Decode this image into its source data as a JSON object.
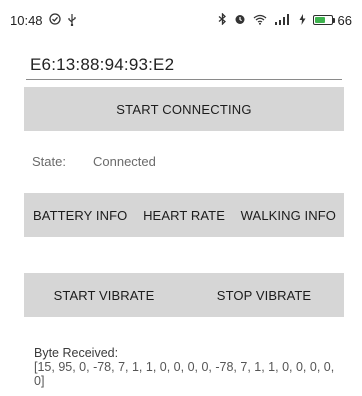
{
  "status_bar": {
    "time": "10:48",
    "left_icons": [
      "clock-check-icon",
      "usb-icon"
    ],
    "right_icons": [
      "bluetooth-icon",
      "alarm-icon",
      "wifi-icon",
      "signal-icon",
      "charging-icon"
    ],
    "signal_text": "ᶦₗₗ",
    "battery_level": "66",
    "battery_fraction": 0.66,
    "battery_color": "#3fb34f"
  },
  "device": {
    "address": "E6:13:88:94:93:E2"
  },
  "buttons": {
    "start_connecting": "START CONNECTING",
    "battery_info": "BATTERY INFO",
    "heart_rate": "HEART RATE",
    "walking_info": "WALKING INFO",
    "start_vibrate": "START VIBRATE",
    "stop_vibrate": "STOP VIBRATE"
  },
  "state": {
    "label": "State:",
    "value": "Connected"
  },
  "bytes": {
    "label": "Byte Received:",
    "value": "[15, 95, 0, -78, 7, 1, 1, 0, 0, 0, 0, -78, 7, 1, 1, 0, 0, 0, 0, 0]"
  },
  "colors": {
    "button_bg": "#d6d6d6",
    "text_primary": "#1c1c1c",
    "text_muted": "#6b6b6b"
  }
}
